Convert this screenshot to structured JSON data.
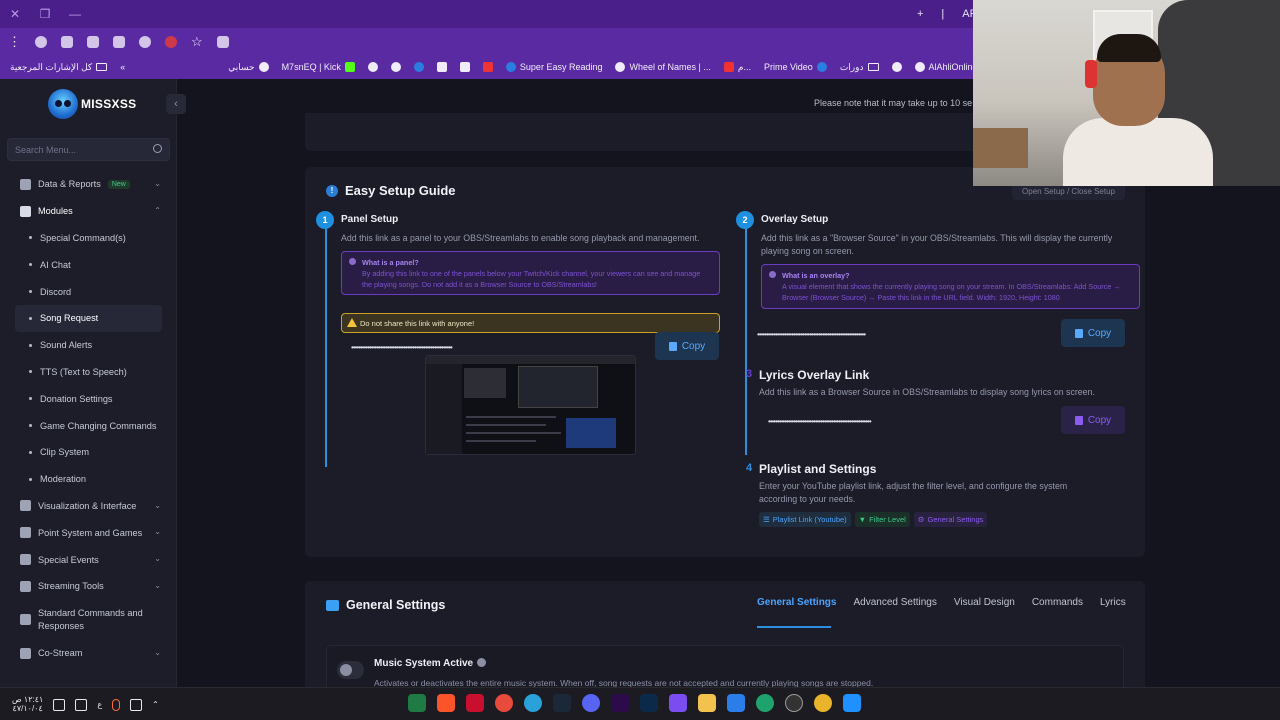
{
  "browser": {
    "tab_title_partial": "API",
    "bookmarks": [
      {
        "label": "كل الإشارات المرجعية",
        "icon": "folder-icon"
      },
      {
        "label": "حسابي",
        "icon": "globe-icon"
      },
      {
        "label": "M7snEQ | Kick",
        "icon": "kick-icon"
      },
      {
        "label": "",
        "icon": "globe-icon"
      },
      {
        "label": "",
        "icon": "globe-icon"
      },
      {
        "label": "",
        "icon": "chrome-icon"
      },
      {
        "label": "",
        "icon": "bookmark-icon"
      },
      {
        "label": "",
        "icon": "grid-icon"
      },
      {
        "label": "",
        "icon": "angular-icon"
      },
      {
        "label": "Super Easy Reading",
        "icon": "globe-icon"
      },
      {
        "label": "Wheel of Names | ...",
        "icon": "globe-icon"
      },
      {
        "label": "م...",
        "icon": "globe-icon"
      },
      {
        "label": "Prime Video",
        "icon": "prime-icon"
      },
      {
        "label": "دورات",
        "icon": "folder-icon"
      },
      {
        "label": "",
        "icon": "globe-icon"
      },
      {
        "label": "AlAhliOnline",
        "icon": "globe-icon"
      }
    ]
  },
  "app": {
    "logo_text": "MISSXSS",
    "notice": "Please note that it may take up to 10 se",
    "search_placeholder": "Search Menu...",
    "nav": [
      {
        "label": "Data & Reports",
        "badge": "New",
        "type": "top",
        "icon": "chart-icon",
        "chevron": "down"
      },
      {
        "label": "Modules",
        "type": "top",
        "icon": "modules-icon",
        "chevron": "up"
      },
      {
        "label": "Special Command(s)",
        "type": "sub"
      },
      {
        "label": "AI Chat",
        "type": "sub"
      },
      {
        "label": "Discord",
        "type": "sub"
      },
      {
        "label": "Song Request",
        "type": "sub",
        "active": true
      },
      {
        "label": "Sound Alerts",
        "type": "sub"
      },
      {
        "label": "TTS (Text to Speech)",
        "type": "sub"
      },
      {
        "label": "Donation Settings",
        "type": "sub"
      },
      {
        "label": "Game Changing Commands",
        "type": "sub"
      },
      {
        "label": "Clip System",
        "type": "sub"
      },
      {
        "label": "Moderation",
        "type": "sub"
      },
      {
        "label": "Visualization & Interface",
        "type": "top",
        "icon": "palette-icon",
        "chevron": "down"
      },
      {
        "label": "Point System and Games",
        "type": "top",
        "icon": "gamepad-icon",
        "chevron": "down"
      },
      {
        "label": "Special Events",
        "type": "top",
        "icon": "calendar-icon",
        "chevron": "down"
      },
      {
        "label": "Streaming Tools",
        "type": "top",
        "icon": "tools-icon",
        "chevron": "down"
      },
      {
        "label": "Standard Commands and Responses",
        "type": "top",
        "icon": "keyboard-icon",
        "chevron": ""
      },
      {
        "label": "Co-Stream",
        "type": "top",
        "icon": "users-icon",
        "chevron": "down"
      }
    ]
  },
  "guide": {
    "title": "Easy Setup Guide",
    "open_close": "Open Setup / Close Setup",
    "panel": {
      "num": "1",
      "title": "Panel Setup",
      "desc": "Add this link as a panel to your OBS/Streamlabs to enable song playback and management.",
      "info_title": "What is a panel?",
      "info_text": "By adding this link to one of the panels below your Twitch/Kick channel, your viewers can see and manage the playing songs. Do not add it as a Browser Source to OBS/Streamlabs!",
      "warning": "Do not share this link with anyone!",
      "link_mask": "••••••••••••••••••••••••••••••••••••••••••••••••••••••••",
      "copy": "Copy"
    },
    "overlay": {
      "num": "2",
      "title": "Overlay Setup",
      "desc": "Add this link as a \"Browser Source\" in your OBS/Streamlabs. This will display the currently playing song on screen.",
      "info_title": "What is an overlay?",
      "info_text": "A visual element that shows the currently playing song on your stream. In OBS/Streamlabs: Add Source → Browser (Browser Source) → Paste this link in the URL field. Width: 1920, Height: 1080",
      "link_mask": "••••••••••••••••••••••••••••••••••••••••••••••••••••••••••••",
      "copy": "Copy"
    },
    "lyrics": {
      "num": "3",
      "title": "Lyrics Overlay Link",
      "desc": "Add this link as a Browser Source in OBS/Streamlabs to display song lyrics on screen.",
      "link_mask": "•••••••••••••••••••••••••••••••••••••••••••••••••••••••••",
      "copy": "Copy"
    },
    "playlist": {
      "num": "4",
      "title": "Playlist and Settings",
      "desc": "Enter your YouTube playlist link, adjust the filter level, and configure the system according to your needs.",
      "chips": [
        "Playlist Link (Youtube)",
        "Filter Level",
        "General Settings"
      ]
    }
  },
  "general": {
    "title": "General Settings",
    "tabs": [
      "General Settings",
      "Advanced Settings",
      "Visual Design",
      "Commands",
      "Lyrics"
    ],
    "setting_name": "Music System Active",
    "setting_desc": "Activates or deactivates the entire music system. When off, song requests are not accepted and currently playing songs are stopped."
  },
  "taskbar": {
    "time": "١٢:٤١ ص",
    "date": "٤٧/١٠/٠٤",
    "lang": "ع"
  },
  "colors": {
    "accent_blue": "#2a8fe0",
    "accent_purple": "#6a3cc1",
    "browser_purple": "#5a2aa3",
    "warning_yellow": "#c9a227"
  }
}
